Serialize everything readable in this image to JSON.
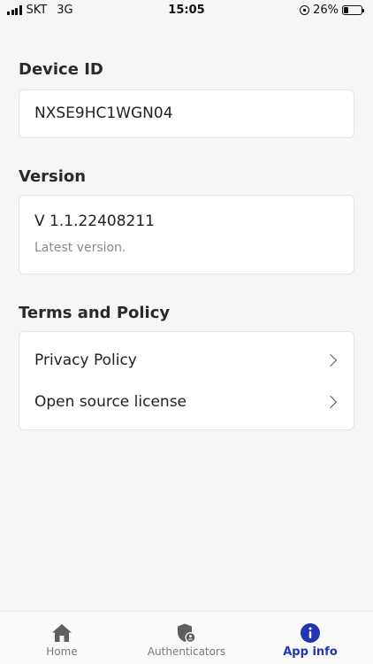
{
  "status_bar": {
    "carrier": "SKT",
    "network": "3G",
    "time": "15:05",
    "battery": "26%",
    "battery_level": 0.26
  },
  "device": {
    "title": "Device ID",
    "value": "NXSE9HC1WGN04"
  },
  "version": {
    "title": "Version",
    "value": "V 1.1.22408211",
    "note": "Latest version."
  },
  "terms": {
    "title": "Terms and Policy",
    "items": [
      {
        "label": "Privacy Policy"
      },
      {
        "label": "Open source license"
      }
    ]
  },
  "tabs": [
    {
      "label": "Home",
      "icon": "home-icon"
    },
    {
      "label": "Authenticators",
      "icon": "shield-user-icon"
    },
    {
      "label": "App info",
      "icon": "info-icon"
    }
  ],
  "colors": {
    "accent": "#2236b0",
    "background": "#f6f6f8"
  }
}
